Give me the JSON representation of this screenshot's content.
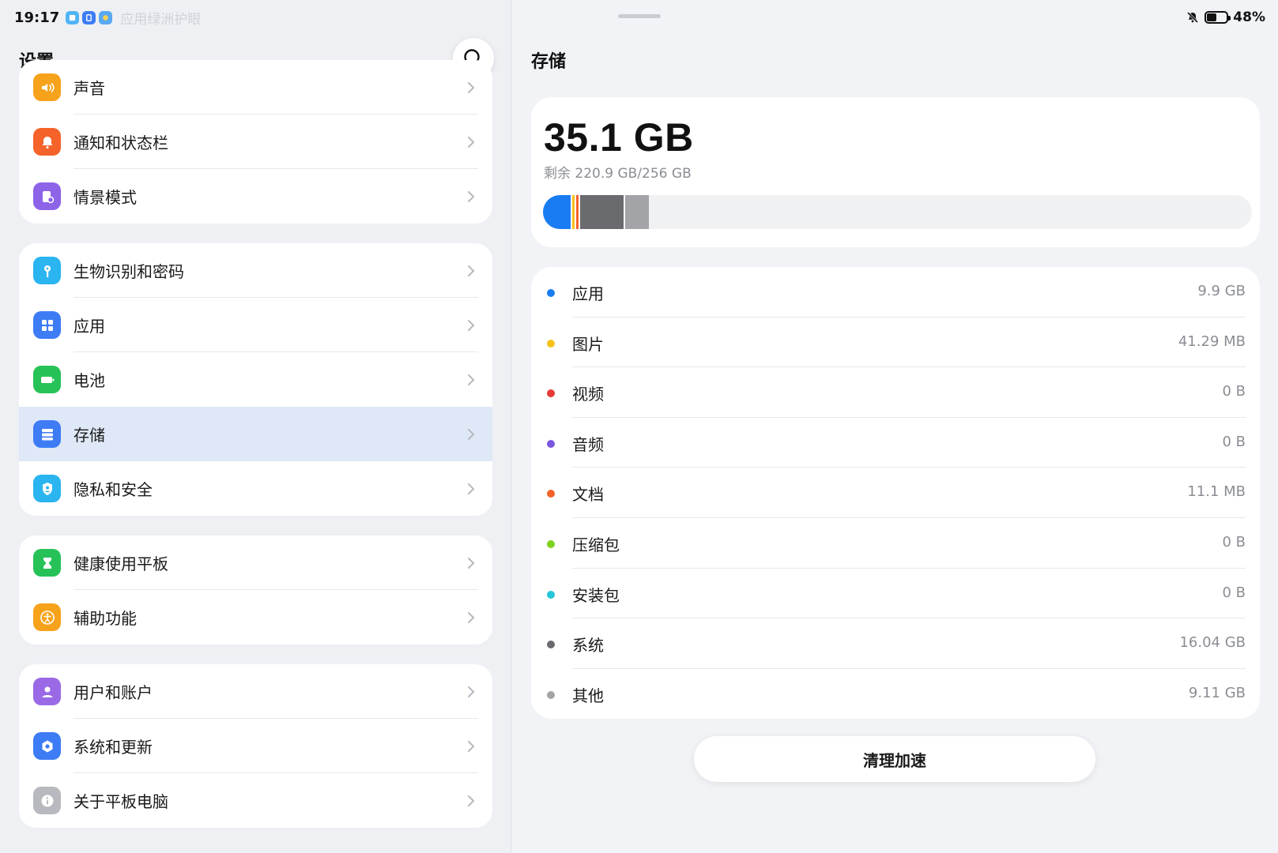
{
  "status_bar": {
    "time": "19:17",
    "faded_banner": "应用绿洲护眼",
    "battery_percent": "48%",
    "battery_level": 0.48,
    "icons": [
      "bell-muted-icon",
      "battery-icon"
    ]
  },
  "left": {
    "title": "设置",
    "search_icon": "search-icon",
    "groups": [
      {
        "items": [
          {
            "label": "声音",
            "icon": "speaker-icon",
            "color": "#f7a21b"
          },
          {
            "label": "通知和状态栏",
            "icon": "notification-icon",
            "color": "#f5632a"
          },
          {
            "label": "情景模式",
            "icon": "scene-mode-icon",
            "color": "#8d63e8"
          }
        ]
      },
      {
        "items": [
          {
            "label": "生物识别和密码",
            "icon": "key-icon",
            "color": "#2ab4f0"
          },
          {
            "label": "应用",
            "icon": "apps-grid-icon",
            "color": "#3d7cf5"
          },
          {
            "label": "电池",
            "icon": "battery-icon",
            "color": "#27c257"
          },
          {
            "label": "存储",
            "icon": "storage-icon",
            "color": "#3d7cf5",
            "selected": true
          },
          {
            "label": "隐私和安全",
            "icon": "privacy-shield-icon",
            "color": "#2ab4f0"
          }
        ]
      },
      {
        "items": [
          {
            "label": "健康使用平板",
            "icon": "hourglass-icon",
            "color": "#27c257"
          },
          {
            "label": "辅助功能",
            "icon": "accessibility-icon",
            "color": "#f7a21b"
          }
        ]
      },
      {
        "items": [
          {
            "label": "用户和账户",
            "icon": "user-icon",
            "color": "#9a6ae6"
          },
          {
            "label": "系统和更新",
            "icon": "system-update-icon",
            "color": "#3d7cf5"
          },
          {
            "label": "关于平板电脑",
            "icon": "info-icon",
            "color": "#b7b9be"
          }
        ]
      }
    ]
  },
  "storage": {
    "title": "存储",
    "used": "35.1 GB",
    "remaining": "剩余 220.9 GB/256 GB",
    "bar_segments": [
      {
        "name": "应用",
        "fraction": 0.0387,
        "color": "#1a7cf2"
      },
      {
        "name": "图片",
        "fraction": 0.006,
        "color": "#f6c21a"
      },
      {
        "name": "文档",
        "fraction": 0.006,
        "color": "#f5632a"
      },
      {
        "name": "系统",
        "fraction": 0.0627,
        "color": "#6a6b6e"
      },
      {
        "name": "其他",
        "fraction": 0.0356,
        "color": "#a3a4a8"
      }
    ],
    "categories": [
      {
        "name": "应用",
        "size": "9.9 GB",
        "color": "#1a7cf2"
      },
      {
        "name": "图片",
        "size": "41.29 MB",
        "color": "#f6c21a"
      },
      {
        "name": "视频",
        "size": "0 B",
        "color": "#e53935"
      },
      {
        "name": "音频",
        "size": "0 B",
        "color": "#7b57e0"
      },
      {
        "name": "文档",
        "size": "11.1 MB",
        "color": "#f5632a"
      },
      {
        "name": "压缩包",
        "size": "0 B",
        "color": "#7ed321"
      },
      {
        "name": "安装包",
        "size": "0 B",
        "color": "#26c6da"
      },
      {
        "name": "系统",
        "size": "16.04 GB",
        "color": "#6a6b6e"
      },
      {
        "name": "其他",
        "size": "9.11 GB",
        "color": "#a3a4a8"
      }
    ],
    "clean_button": "清理加速"
  }
}
